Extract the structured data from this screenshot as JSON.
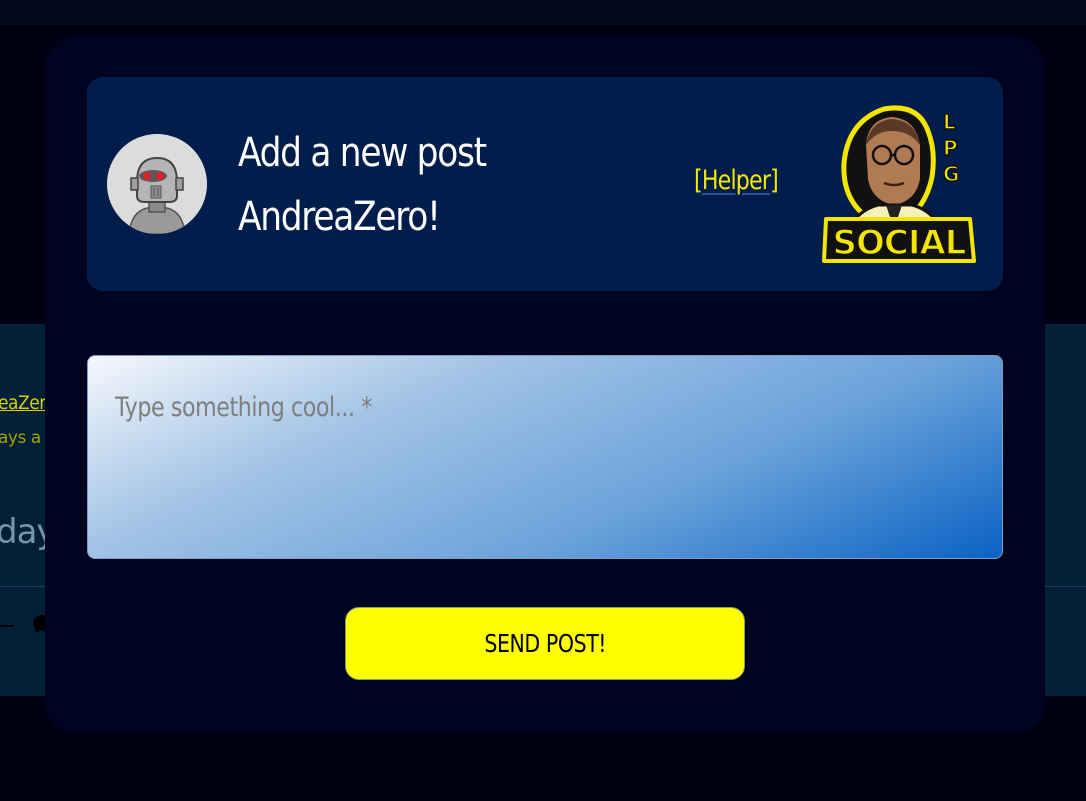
{
  "background_post": {
    "author_link": "eaZer",
    "time_ago": "ays a",
    "text": "day"
  },
  "modal": {
    "header": {
      "title_line1": "Add a new post",
      "title_line2": "AndreaZero!",
      "helper_open": "[",
      "helper_label": "Helper",
      "helper_close": "]",
      "logo_text": "SOCIAL",
      "logo_letters": [
        "L",
        "P",
        "G"
      ]
    },
    "post_input": {
      "placeholder": "Type something cool... *",
      "value": ""
    },
    "send_label": "SEND POST!"
  },
  "colors": {
    "page_bg": "#000013",
    "modal_bg": "#000420",
    "header_bg": "#001d4b",
    "accent_yellow": "#ffff00",
    "helper_yellow": "#f5e800"
  }
}
